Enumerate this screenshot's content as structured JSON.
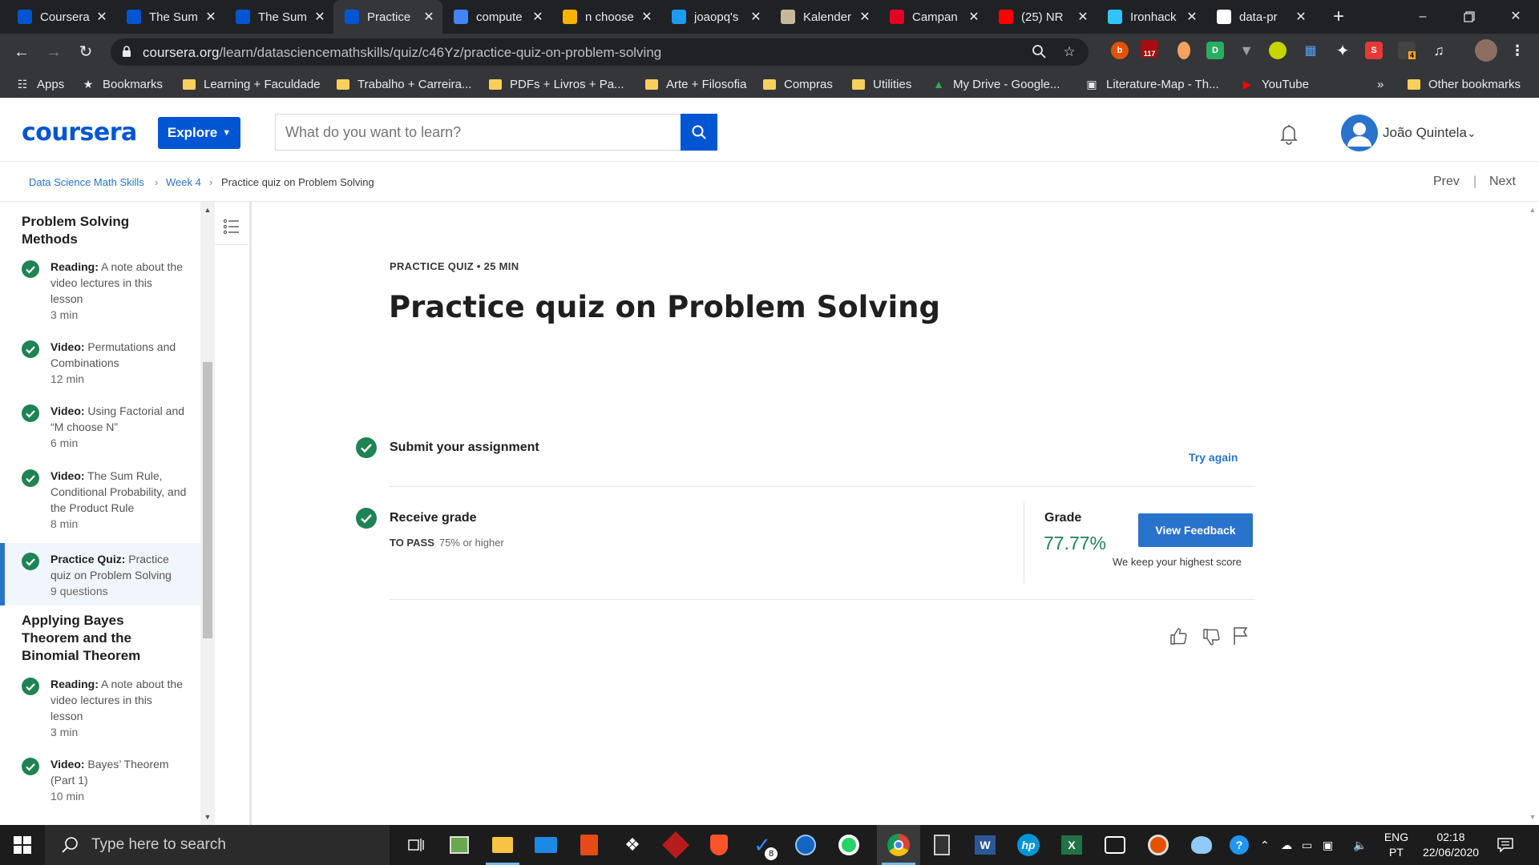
{
  "browser": {
    "tabs": [
      {
        "title": "Coursera",
        "icon": "coursera-icon",
        "color": "#0056d2"
      },
      {
        "title": "The Sum",
        "icon": "coursera-icon",
        "color": "#0056d2"
      },
      {
        "title": "The Sum",
        "icon": "coursera-icon",
        "color": "#0056d2"
      },
      {
        "title": "Practice",
        "icon": "coursera-icon",
        "color": "#0056d2",
        "active": true
      },
      {
        "title": "compute",
        "icon": "google-icon",
        "color": "#4285f4"
      },
      {
        "title": "n choose",
        "icon": "sketch-icon",
        "color": "#f7b500"
      },
      {
        "title": "joaopq's",
        "icon": "blue-wing-icon",
        "color": "#1d9bf0"
      },
      {
        "title": "Kalender",
        "icon": "page-icon",
        "color": "#c8b89a"
      },
      {
        "title": "Campan",
        "icon": "pinterest-icon",
        "color": "#e60023"
      },
      {
        "title": "(25) NR",
        "icon": "youtube-icon",
        "color": "#ff0000"
      },
      {
        "title": "Ironhack",
        "icon": "ironhack-icon",
        "color": "#32c3ff"
      },
      {
        "title": "data-pr",
        "icon": "github-icon",
        "color": "#ffffff"
      }
    ],
    "url_host": "coursera.org",
    "url_path": "/learn/datasciencemathskills/quiz/c46Yz/practice-quiz-on-problem-solving",
    "bookmarks": [
      {
        "label": "Apps",
        "type": "apps"
      },
      {
        "label": "Bookmarks",
        "type": "star"
      },
      {
        "label": "Learning + Faculdade",
        "type": "folder"
      },
      {
        "label": "Trabalho + Carreira...",
        "type": "folder"
      },
      {
        "label": "PDFs + Livros + Pa...",
        "type": "folder"
      },
      {
        "label": "Arte + Filosofia",
        "type": "folder"
      },
      {
        "label": "Compras",
        "type": "folder"
      },
      {
        "label": "Utilities",
        "type": "folder"
      },
      {
        "label": "My Drive - Google...",
        "type": "drive"
      },
      {
        "label": "Literature-Map - Th...",
        "type": "page"
      },
      {
        "label": "YouTube",
        "type": "youtube"
      }
    ],
    "bookmarks_overflow": "»",
    "other_bookmarks": "Other bookmarks",
    "extension_badges": {
      "ext2": "117",
      "ext12": "4"
    }
  },
  "header": {
    "logo": "coursera",
    "explore_label": "Explore",
    "search_placeholder": "What do you want to learn?",
    "user_name": "João Quintela"
  },
  "breadcrumb": {
    "items": [
      "Data Science Math Skills",
      "Week 4",
      "Practice quiz on Problem Solving"
    ],
    "prev": "Prev",
    "next": "Next"
  },
  "sidebar": {
    "sections": [
      {
        "title": "Problem Solving Methods",
        "items": [
          {
            "type": "Reading:",
            "name": "A note about the video lectures in this lesson",
            "meta": "3 min"
          },
          {
            "type": "Video:",
            "name": "Permutations and Combinations",
            "meta": "12 min"
          },
          {
            "type": "Video:",
            "name": "Using Factorial and “M choose N”",
            "meta": "6 min"
          },
          {
            "type": "Video:",
            "name": "The Sum Rule, Conditional Probability, and the Product Rule",
            "meta": "8 min"
          },
          {
            "type": "Practice Quiz:",
            "name": "Practice quiz on Problem Solving",
            "meta": "9 questions",
            "active": true
          }
        ]
      },
      {
        "title": "Applying Bayes Theorem and the Binomial Theorem",
        "items": [
          {
            "type": "Reading:",
            "name": "A note about the video lectures in this lesson",
            "meta": "3 min"
          },
          {
            "type": "Video:",
            "name": "Bayes’ Theorem (Part 1)",
            "meta": "10 min"
          }
        ]
      }
    ]
  },
  "quiz": {
    "eyebrow": "PRACTICE QUIZ • 25 MIN",
    "title": "Practice quiz on Problem Solving",
    "submit_title": "Submit your assignment",
    "try_again": "Try again",
    "receive_title": "Receive grade",
    "to_pass_label": "TO PASS",
    "to_pass_value": "75% or higher",
    "grade_label": "Grade",
    "grade_value": "77.77%",
    "view_feedback": "View Feedback",
    "keep_note": "We keep your highest score"
  },
  "taskbar": {
    "search_placeholder": "Type here to search",
    "todo_badge": "8",
    "lang_top": "ENG",
    "lang_bottom": "PT",
    "time": "02:18",
    "date": "22/06/2020"
  },
  "colors": {
    "brand": "#0056d2",
    "link": "#2a73cc",
    "success": "#1f8354"
  }
}
